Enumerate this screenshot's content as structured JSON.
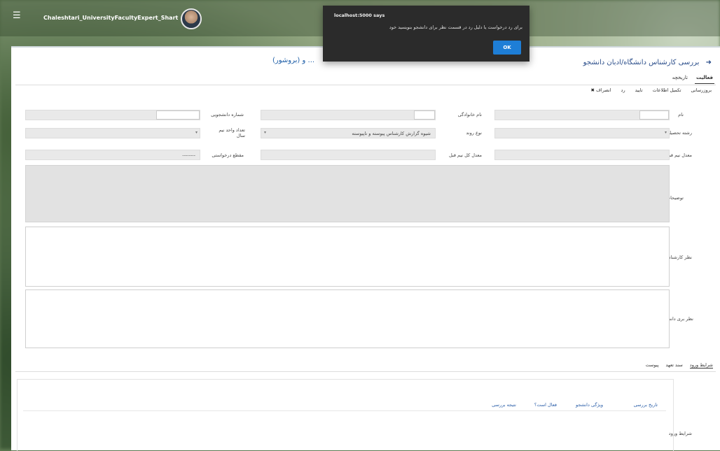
{
  "header": {
    "username": "Chaleshtari_UniversityFacultyExpert_Shart"
  },
  "page": {
    "title": "بررسی کارشناس دانشگاه/ادبان دانشجو",
    "subtitle": "(بروشور) و ...",
    "tabs": [
      "فعالیت",
      "تاریخچه"
    ]
  },
  "toolbar": {
    "items": [
      "بروزرسانی",
      "تکمیل اطلاعات",
      "تایید",
      "رد",
      "انصراف"
    ]
  },
  "form": {
    "name_label": "نام",
    "family_label": "نام خانوادگی",
    "student_no_label": "شماره دانشجویی",
    "field_label": "رشته تحصیلی",
    "process_label": "نوع روند",
    "process_value": "شیوه گزارش کارشناس پیوسته و ناپیوسته",
    "units_label": "تعداد واحد نیم سال",
    "prev_avg_label": "معدل نیم قبل",
    "total_avg_label": "معدل کل نیم قبل",
    "level_label": "مقطع درخواستی",
    "level_value": "--------",
    "desc_label": "توضیحات",
    "expert_opinion_label": "نظر کارشناس",
    "student_opinion_label": "نظر بری دانشجو"
  },
  "sections": {
    "tabs": [
      "شرایط ورود",
      "سند تعهد",
      "پیوست"
    ],
    "conditions_label": "شرایط ورود",
    "table_headers": [
      "تاریخ بررسی",
      "ویژگی دانشجو",
      "فعال است؟",
      "نتیجه بررسی"
    ]
  },
  "dialog": {
    "host": "localhost:5000 says",
    "message": "برای رد درخواست یا دلیل رد در قسمت نظر برای دانشجو بنویسید خود",
    "ok_label": "OK"
  }
}
